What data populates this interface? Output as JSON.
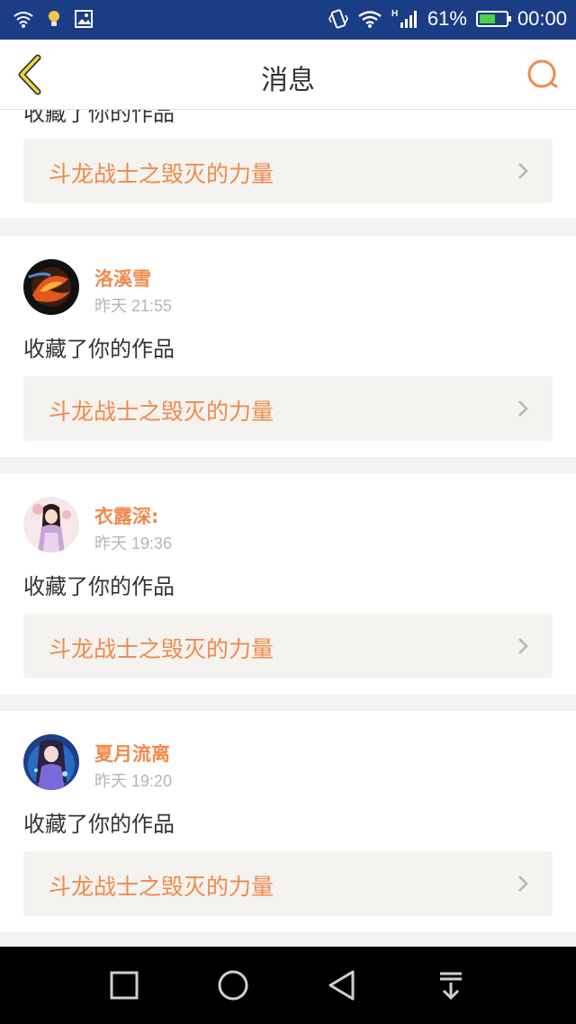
{
  "status_bar": {
    "battery_percent": "61%",
    "battery_level": 0.61,
    "time": "00:00",
    "signal_type": "H",
    "colors": {
      "background": "#1b3d86",
      "battery_fill": "#4bd04b"
    },
    "icons": [
      "wifi-icon",
      "notification-bulb-icon",
      "gallery-icon",
      "vibrate-icon",
      "wifi-signal-icon",
      "cell-signal-icon",
      "battery-icon"
    ]
  },
  "header": {
    "title": "消息",
    "back_icon": "chevron-left-icon",
    "search_icon": "search-icon",
    "accent_color": "#f08a4b"
  },
  "messages": [
    {
      "action": "收藏了你的作品",
      "work_title": "斗龙战士之毁灭的力量"
    },
    {
      "user_name": "洛溪雪",
      "time": "昨天 21:55",
      "action": "收藏了你的作品",
      "work_title": "斗龙战士之毁灭的力量"
    },
    {
      "user_name": "衣露深:",
      "time": "昨天 19:36",
      "action": "收藏了你的作品",
      "work_title": "斗龙战士之毁灭的力量"
    },
    {
      "user_name": "夏月流离",
      "time": "昨天 19:20",
      "action": "收藏了你的作品",
      "work_title": "斗龙战士之毁灭的力量"
    }
  ],
  "nav_bar": {
    "icons": [
      "recent-apps-icon",
      "home-icon",
      "back-icon",
      "notification-pull-icon"
    ]
  }
}
